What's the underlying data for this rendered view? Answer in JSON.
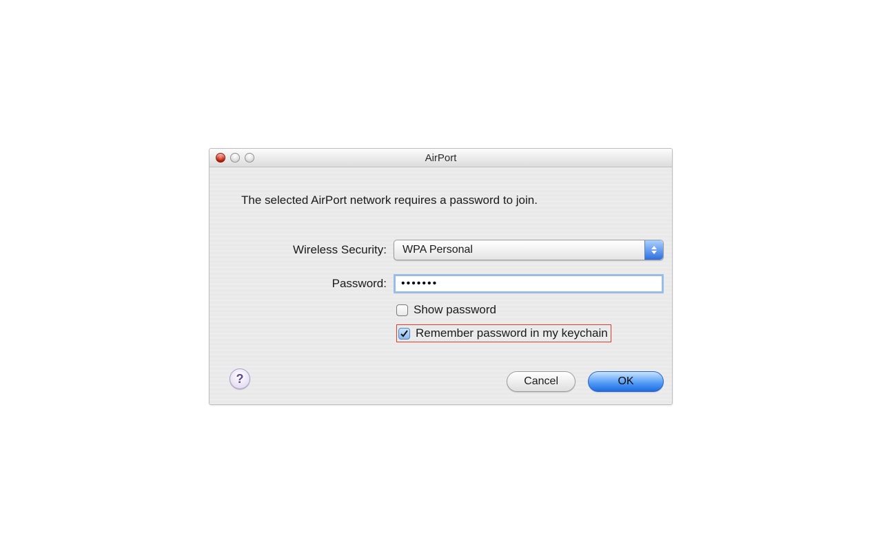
{
  "window": {
    "title": "AirPort"
  },
  "message": "The selected AirPort network requires a password to join.",
  "form": {
    "security_label": "Wireless Security:",
    "security_value": "WPA Personal",
    "password_label": "Password:",
    "password_value": "•••••••",
    "show_password_label": "Show password",
    "show_password_checked": false,
    "remember_label": "Remember password in my keychain",
    "remember_checked": true
  },
  "buttons": {
    "help": "?",
    "cancel": "Cancel",
    "ok": "OK"
  }
}
